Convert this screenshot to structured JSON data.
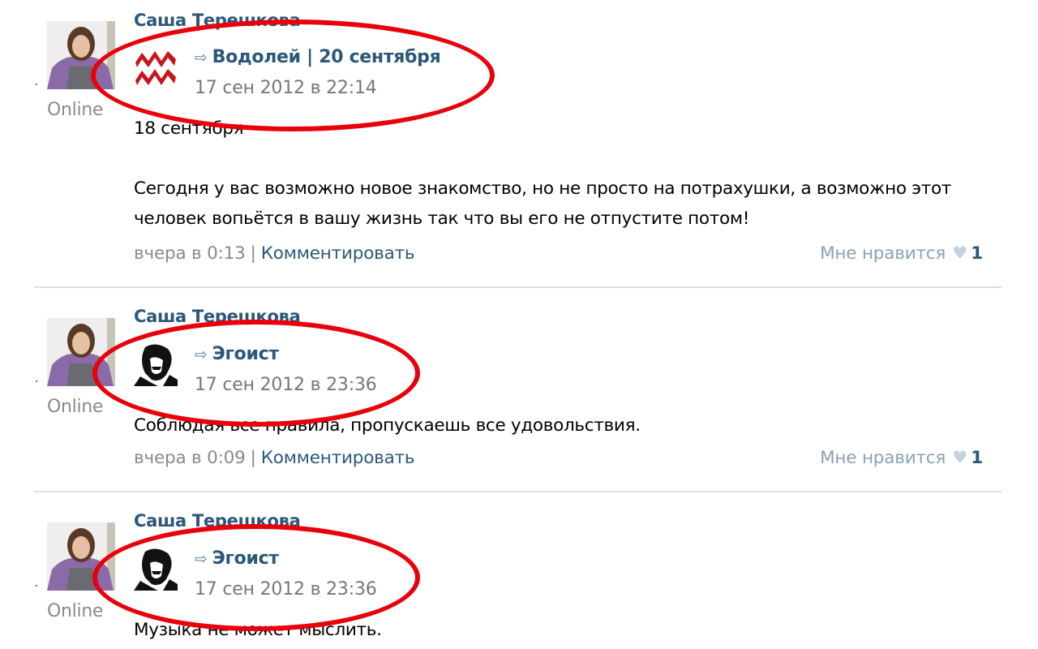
{
  "posts": [
    {
      "author": "Саша Терешкова",
      "status": "Online",
      "repost_title": "Водолей | 20 сентября",
      "repost_icon": "aquarius-icon",
      "repost_date": "17 сен 2012 в 22:14",
      "text_lines": [
        "18 сентября",
        "",
        "Сегодня у вас возможно новое знакомство, но не просто на потрахушки, а возможно этот",
        "человек вопьётся в вашу жизнь так что вы его не отпустите потом!"
      ],
      "time": "вчера в 0:13",
      "comment_label": "Комментировать",
      "like_label": "Мне нравится",
      "like_count": "1"
    },
    {
      "author": "Саша Терешкова",
      "status": "Online",
      "repost_title": "Эгоист",
      "repost_icon": "joker-icon",
      "repost_date": "17 сен 2012 в 23:36",
      "text_lines": [
        "Соблюдая все правила, пропускаешь все удовольствия."
      ],
      "time": "вчера в 0:09",
      "comment_label": "Комментировать",
      "like_label": "Мне нравится",
      "like_count": "1"
    },
    {
      "author": "Саша Терешкова",
      "status": "Online",
      "repost_title": "Эгоист",
      "repost_icon": "joker-icon",
      "repost_date": "17 сен 2012 в 23:36",
      "text_lines": [
        "Музыка не может мыслить."
      ]
    }
  ],
  "colors": {
    "link": "#2b587a",
    "muted": "#8a8a8a",
    "highlight": "#e8000a",
    "divider": "#dae1e8"
  }
}
